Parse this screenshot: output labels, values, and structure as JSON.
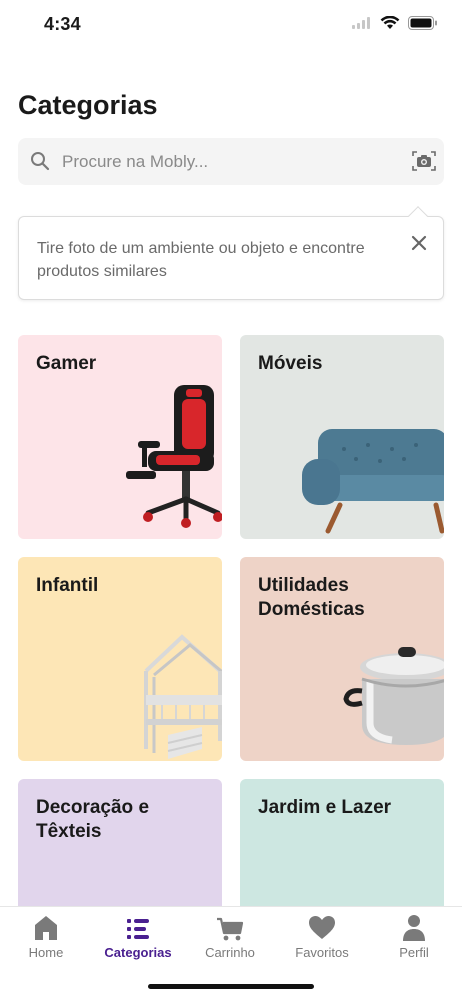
{
  "status": {
    "time": "4:34"
  },
  "page": {
    "title": "Categorias"
  },
  "search": {
    "placeholder": "Procure na Mobly..."
  },
  "tooltip": {
    "text": "Tire foto de um ambiente ou objeto e encontre produtos similares"
  },
  "categories": [
    {
      "label": "Gamer",
      "color": "#fde4e8"
    },
    {
      "label": "Móveis",
      "color": "#e2e6e3"
    },
    {
      "label": "Infantil",
      "color": "#fde6b6"
    },
    {
      "label": "Utilidades Domésticas",
      "color": "#eed3c7"
    },
    {
      "label": "Decoração e Têxteis",
      "color": "#e1d5ec"
    },
    {
      "label": "Jardim e Lazer",
      "color": "#cde7e1"
    }
  ],
  "tabs": [
    {
      "label": "Home",
      "icon": "home-icon"
    },
    {
      "label": "Categorias",
      "icon": "list-icon",
      "active": true
    },
    {
      "label": "Carrinho",
      "icon": "cart-icon"
    },
    {
      "label": "Favoritos",
      "icon": "heart-icon"
    },
    {
      "label": "Perfil",
      "icon": "person-icon"
    }
  ],
  "colors": {
    "accent": "#4a2090",
    "inactive": "#7a7a7a"
  }
}
